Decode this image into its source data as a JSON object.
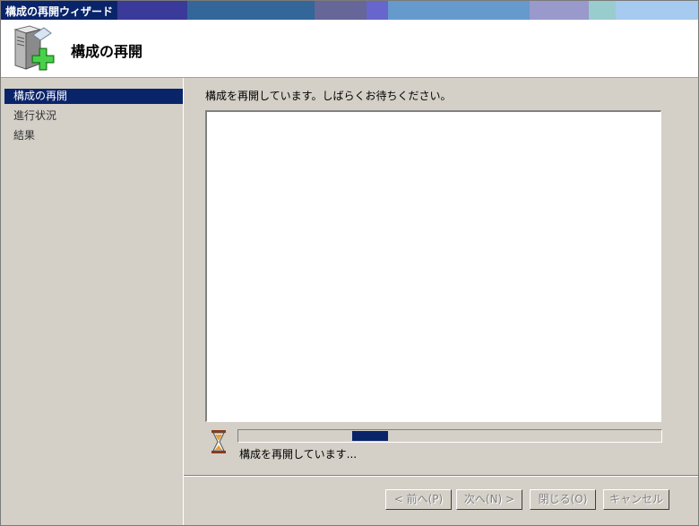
{
  "window": {
    "title": "構成の再開ウィザード",
    "title_bar_colors": [
      "#0a246a",
      "#3a3a9a",
      "#336699",
      "#666699",
      "#6666cc",
      "#6699cc",
      "#9999cc",
      "#99cccc",
      "#a6caf0"
    ]
  },
  "header": {
    "title": "構成の再開",
    "icon": "server-with-green-plus-icon"
  },
  "nav": {
    "items": [
      {
        "label": "構成の再開",
        "active": true
      },
      {
        "label": "進行状況",
        "active": false
      },
      {
        "label": "結果",
        "active": false
      }
    ]
  },
  "main": {
    "status_text": "構成を再開しています。しばらくお待ちください。",
    "progress": {
      "label": "構成を再開しています...",
      "indeterminate": true,
      "marker_start_fraction": 0.27,
      "marker_width_fraction": 0.085,
      "color": "#0a246a"
    },
    "busy_icon": "hourglass-icon"
  },
  "buttons": {
    "back": "< 前へ(P)",
    "next": "次へ(N) >",
    "close": "閉じる(O)",
    "cancel": "キャンセル"
  }
}
